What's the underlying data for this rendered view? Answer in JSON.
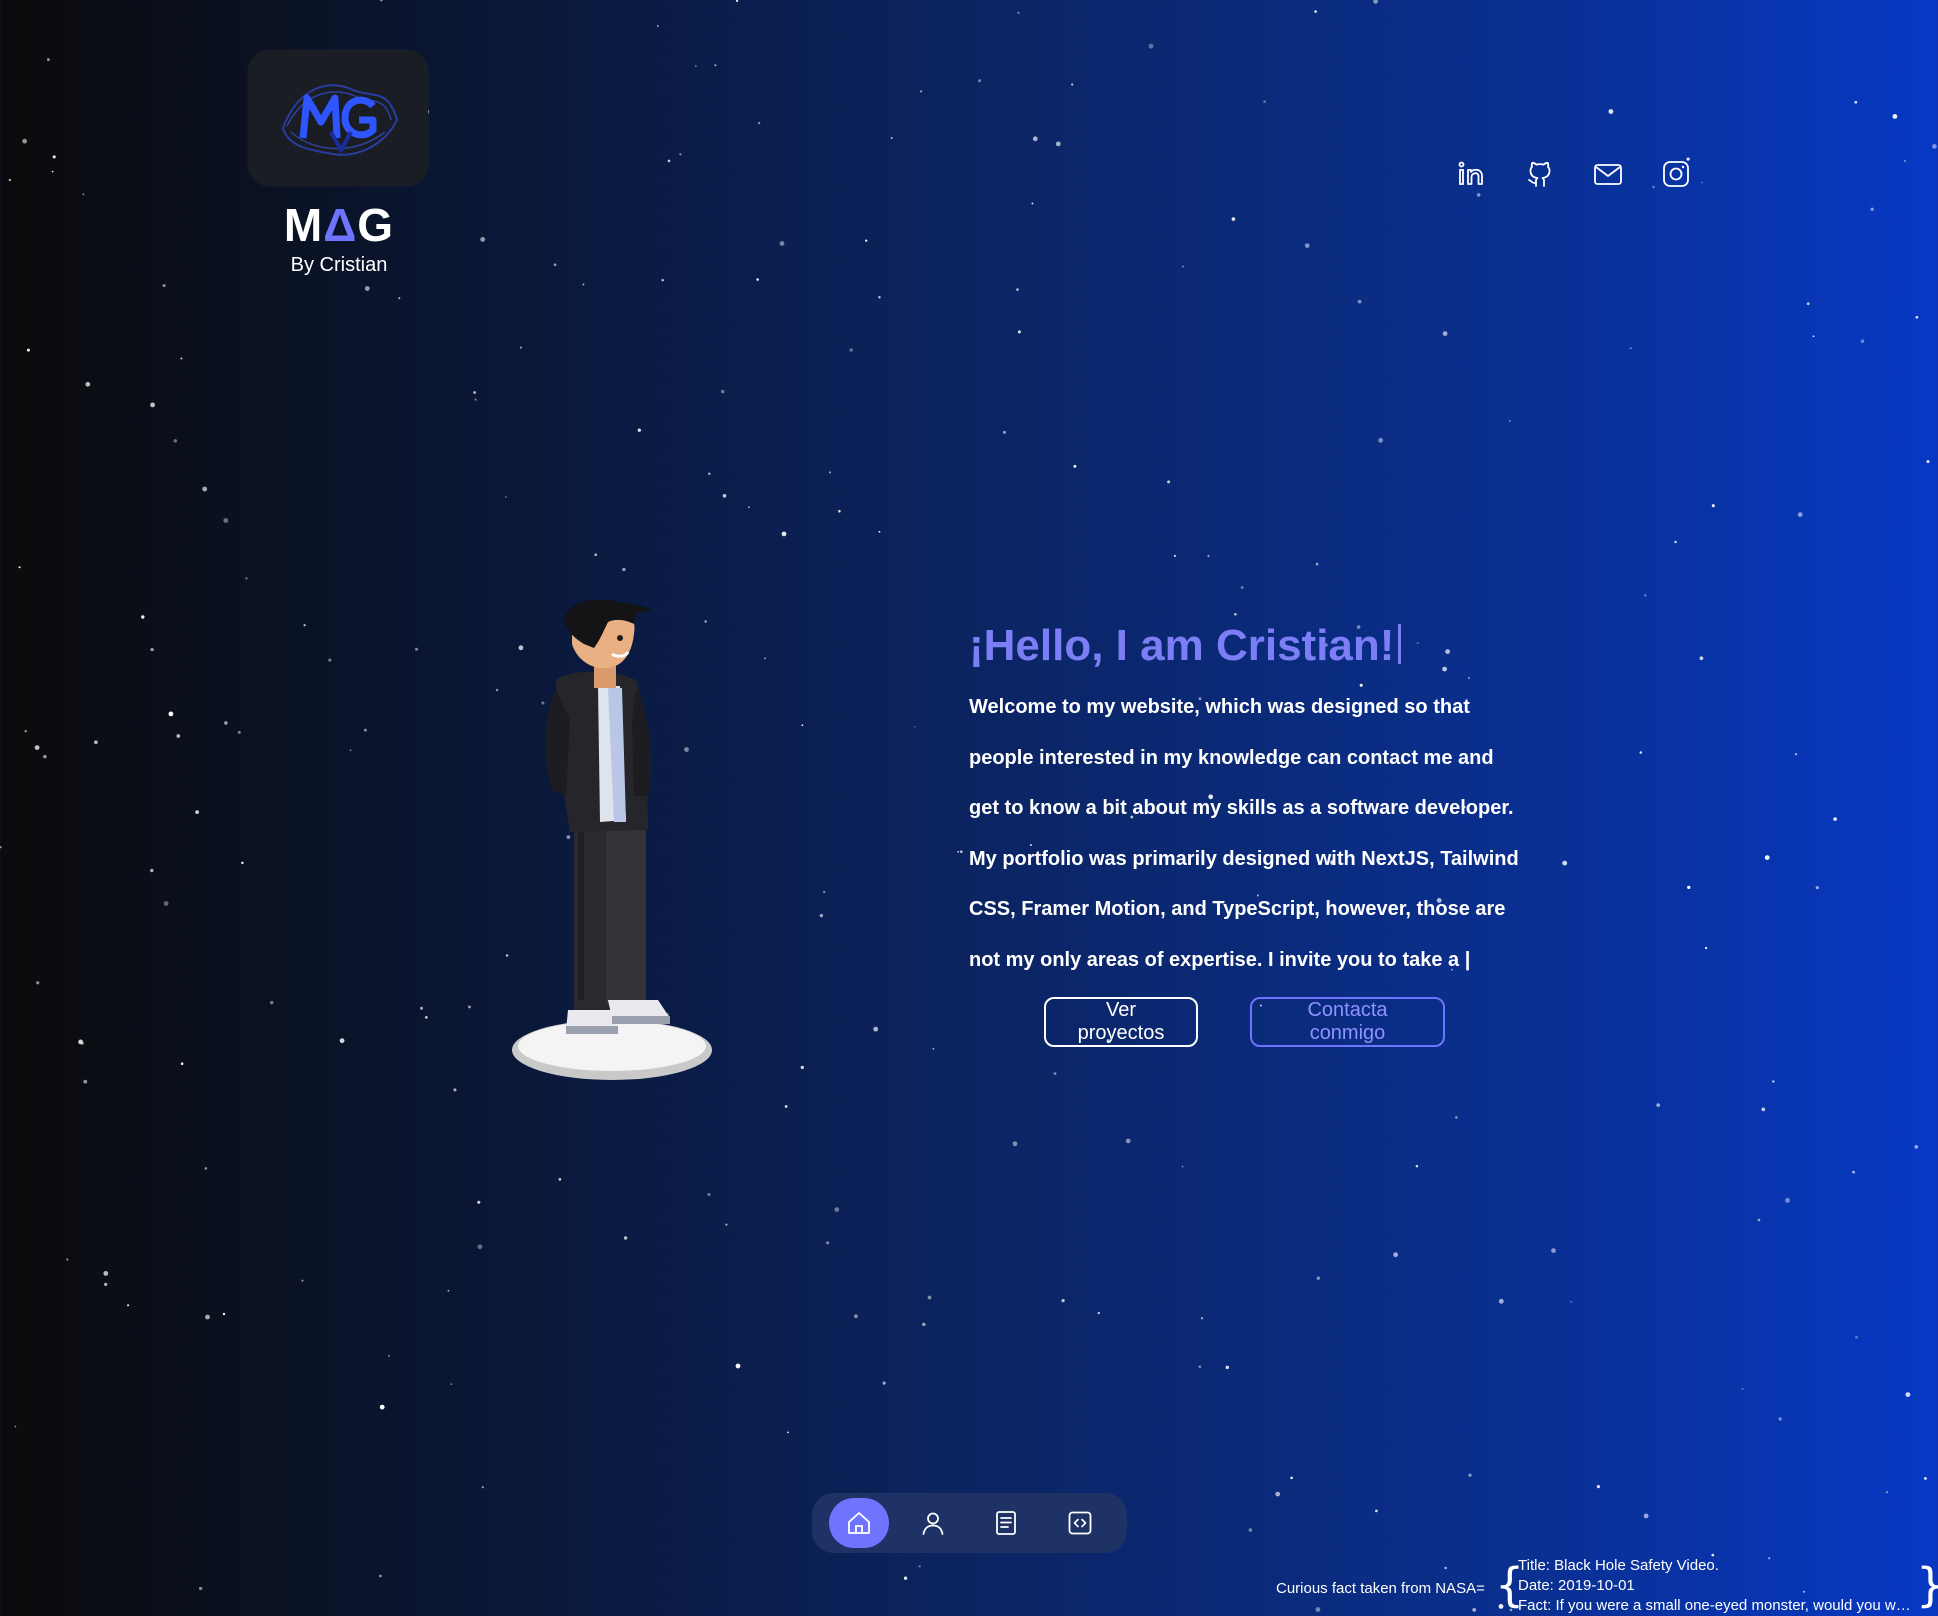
{
  "brand": {
    "logo_icon": "mg-monogram-logo",
    "title_before": "M",
    "title_accent": "Δ",
    "title_after": "G",
    "subtitle": "By Cristian"
  },
  "socials": [
    {
      "name": "linkedin",
      "icon": "linkedin-icon"
    },
    {
      "name": "github",
      "icon": "github-icon"
    },
    {
      "name": "email",
      "icon": "mail-icon"
    },
    {
      "name": "instagram",
      "icon": "instagram-icon"
    }
  ],
  "hero": {
    "heading": "¡Hello, I am Cristian!",
    "lines": [
      "Welcome to my website, which was designed so that",
      "people interested in my knowledge can contact me and",
      "get to know a bit about my skills as a software developer.",
      "My portfolio was primarily designed with NextJS, Tailwind",
      "CSS, Framer Motion, and TypeScript, however, those are",
      "not my only areas of expertise. I invite you to take a |"
    ],
    "primary_button": "Ver proyectos",
    "secondary_button": "Contacta conmigo"
  },
  "dock": {
    "items": [
      {
        "name": "home",
        "icon": "home-icon",
        "active": true
      },
      {
        "name": "about",
        "icon": "user-icon",
        "active": false
      },
      {
        "name": "resume",
        "icon": "document-icon",
        "active": false
      },
      {
        "name": "projects",
        "icon": "code-icon",
        "active": false
      }
    ]
  },
  "nasa": {
    "label": "Curious fact taken from NASA=",
    "open_brace": "{",
    "close_brace": "}",
    "title": "Title: Black Hole Safety Video.",
    "date": "Date: 2019-10-01",
    "fact": "Fact: If you were a small one-eyed monster, would you wa..."
  },
  "colors": {
    "accent": "#6f74ff",
    "heading": "#7b7ef4",
    "background_left": "#0b0b0c",
    "background_right": "#0738c4",
    "dock_background": "#1e3266"
  }
}
